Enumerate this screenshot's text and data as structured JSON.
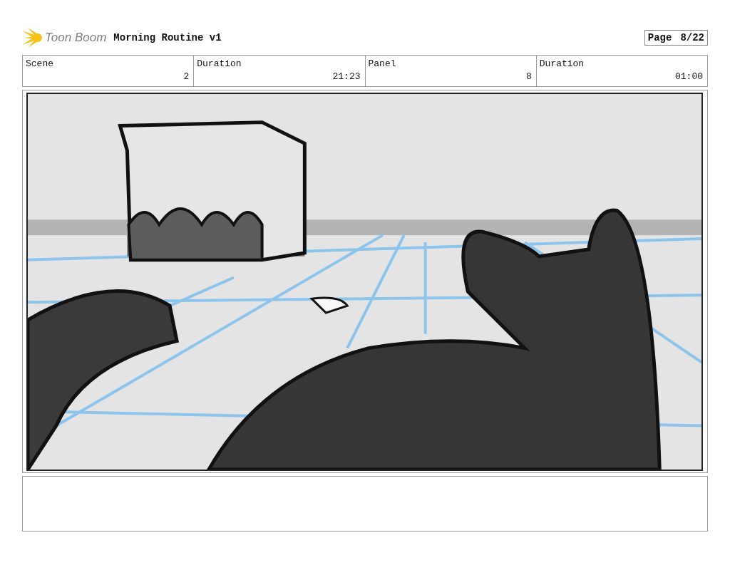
{
  "header": {
    "logo_text": "Toon Boom",
    "title": "Morning Routine v1",
    "page_label": "Page",
    "page_number": "8/22"
  },
  "info_table": {
    "columns": [
      "Scene",
      "Duration",
      "Panel",
      "Duration"
    ],
    "rows": [
      [
        "2",
        "21:23",
        "8",
        "01:00"
      ]
    ]
  },
  "panel": {
    "kind": "drawing"
  }
}
